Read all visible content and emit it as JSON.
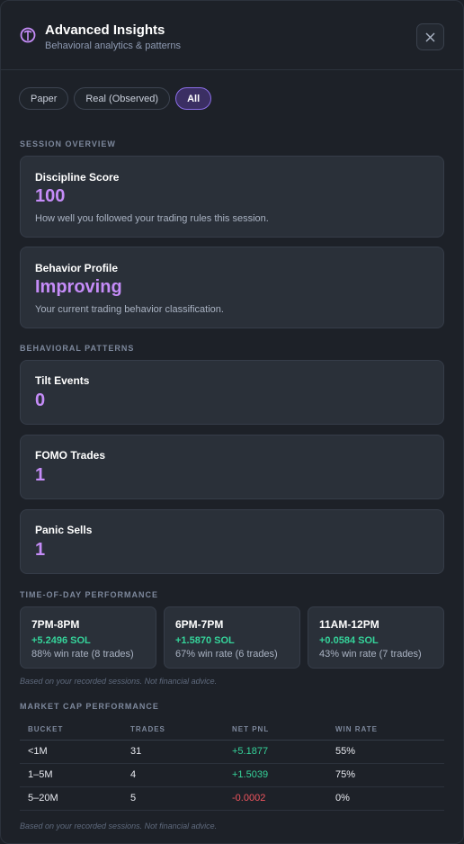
{
  "header": {
    "title": "Advanced Insights",
    "subtitle": "Behavioral analytics & patterns",
    "icon": "brain-icon"
  },
  "filters": [
    {
      "label": "Paper",
      "active": false
    },
    {
      "label": "Real (Observed)",
      "active": false
    },
    {
      "label": "All",
      "active": true
    }
  ],
  "session_overview": {
    "label": "SESSION OVERVIEW",
    "discipline": {
      "title": "Discipline Score",
      "value": "100",
      "desc": "How well you followed your trading rules this session."
    },
    "profile": {
      "title": "Behavior Profile",
      "value": "Improving",
      "desc": "Your current trading behavior classification."
    }
  },
  "behavioral_patterns": {
    "label": "BEHAVIORAL PATTERNS",
    "items": [
      {
        "title": "Tilt Events",
        "value": "0"
      },
      {
        "title": "FOMO Trades",
        "value": "1"
      },
      {
        "title": "Panic Sells",
        "value": "1"
      }
    ]
  },
  "time_of_day": {
    "label": "TIME-OF-DAY PERFORMANCE",
    "items": [
      {
        "time": "7PM-8PM",
        "pnl": "+5.2496 SOL",
        "rate": "88% win rate (8 trades)"
      },
      {
        "time": "6PM-7PM",
        "pnl": "+1.5870 SOL",
        "rate": "67% win rate (6 trades)"
      },
      {
        "time": "11AM-12PM",
        "pnl": "+0.0584 SOL",
        "rate": "43% win rate (7 trades)"
      }
    ],
    "note": "Based on your recorded sessions. Not financial advice."
  },
  "market_cap": {
    "label": "MARKET CAP PERFORMANCE",
    "columns": [
      "BUCKET",
      "TRADES",
      "NET PNL",
      "WIN RATE"
    ],
    "rows": [
      {
        "bucket": "<1M",
        "trades": "31",
        "pnl": "+5.1877",
        "win": "55%"
      },
      {
        "bucket": "1–5M",
        "trades": "4",
        "pnl": "+1.5039",
        "win": "75%"
      },
      {
        "bucket": "5–20M",
        "trades": "5",
        "pnl": "-0.0002",
        "win": "0%"
      }
    ],
    "note": "Based on your recorded sessions. Not financial advice."
  },
  "colors": {
    "accent": "#c58cf8",
    "positive": "#35d39a",
    "negative": "#f0555e"
  }
}
